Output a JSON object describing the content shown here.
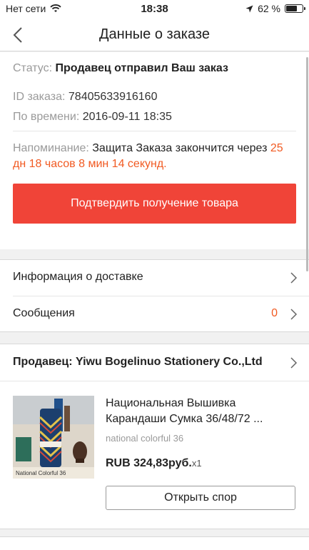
{
  "status_bar": {
    "carrier": "Нет сети",
    "time": "18:38",
    "battery": "62 %"
  },
  "nav": {
    "title": "Данные о заказе"
  },
  "order": {
    "status_label": "Статус:",
    "status_value": "Продавец отправил Ваш заказ",
    "id_label": "ID заказа:",
    "id_value": "78405633916160",
    "time_label": "По времени:",
    "time_value": "2016-09-11 18:35",
    "reminder_label": "Напоминание:",
    "reminder_text": "Защита Заказа закончится через",
    "countdown": "25 дн 18 часов 8 мин 14 секунд",
    "countdown_suffix": ".",
    "confirm_button": "Подтвердить получение товара"
  },
  "list": {
    "delivery_label": "Информация о доставке",
    "messages_label": "Сообщения",
    "messages_count": "0"
  },
  "seller": {
    "name": "Продавец: Yiwu Bogelinuo Stationery Co.,Ltd",
    "product": {
      "title": "Национальная Вышивка Карандаши Сумка 36/48/72 ...",
      "sku": "national colorful 36",
      "price": "RUB 324,83руб.",
      "qty": "x1",
      "image_caption": "National Colorful 36"
    },
    "dispute_button": "Открыть спор"
  },
  "colors": {
    "accent": "#f04438",
    "countdown": "#f15a22"
  }
}
